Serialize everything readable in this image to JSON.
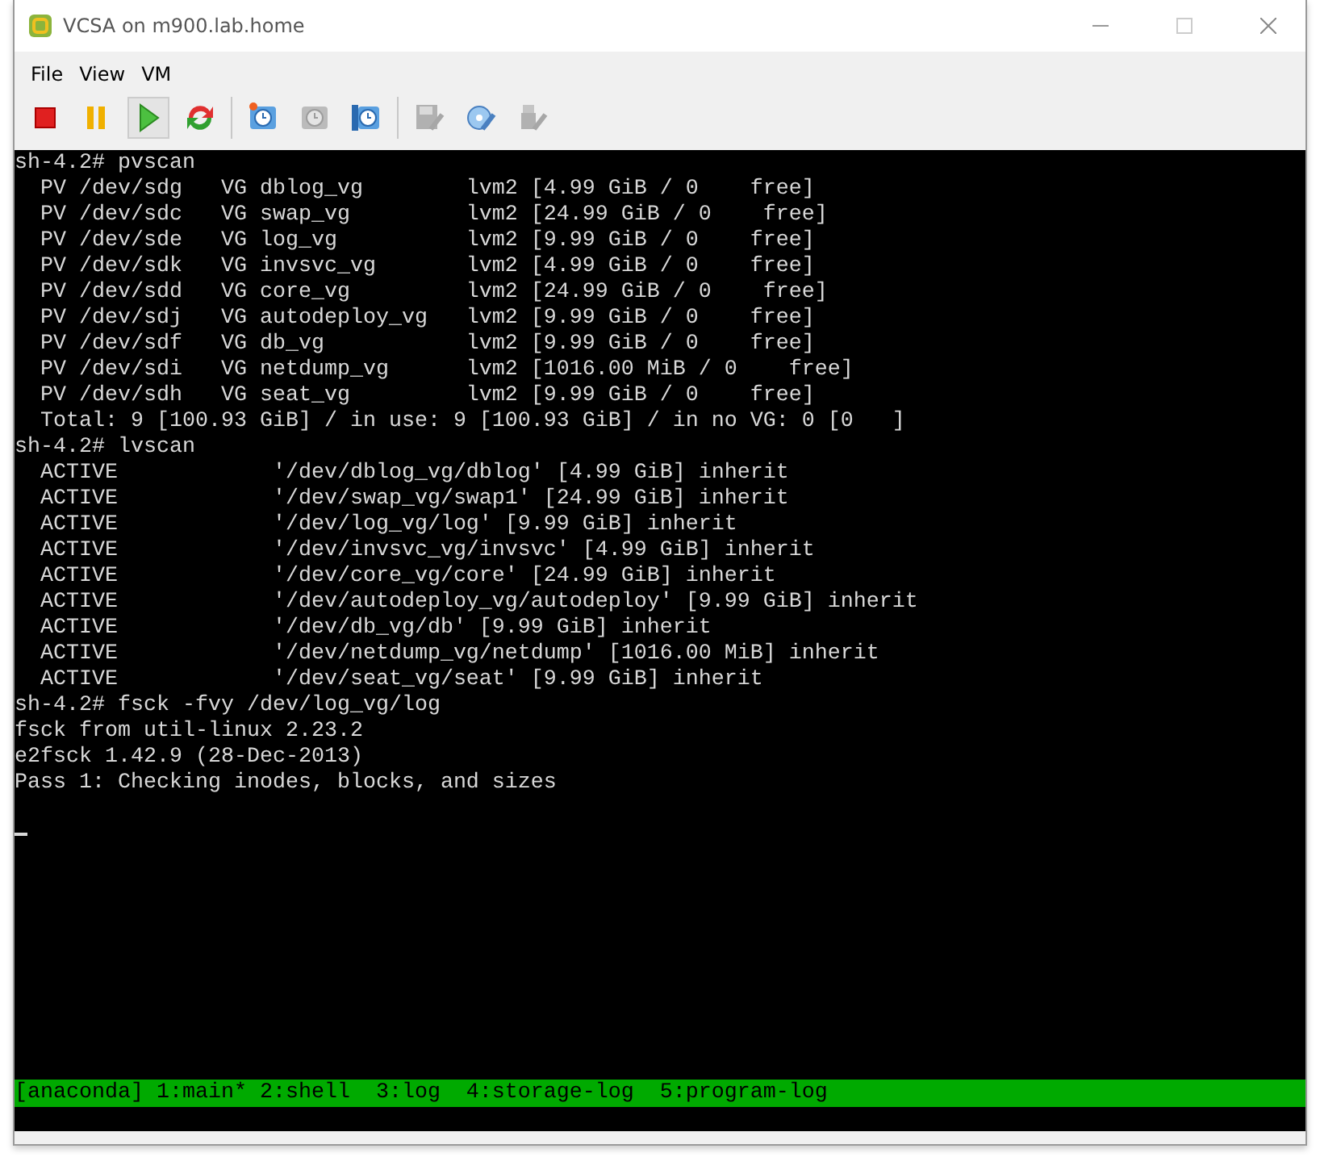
{
  "window": {
    "title": "VCSA on m900.lab.home"
  },
  "menu": [
    "File",
    "View",
    "VM"
  ],
  "toolbar": [
    {
      "kind": "stop",
      "disabled": false,
      "pressed": false
    },
    {
      "kind": "pause",
      "disabled": false,
      "pressed": false
    },
    {
      "kind": "play",
      "disabled": false,
      "pressed": true
    },
    {
      "kind": "reset",
      "disabled": false,
      "pressed": false
    },
    {
      "kind": "separator"
    },
    {
      "kind": "snapshot-take",
      "disabled": false,
      "pressed": false
    },
    {
      "kind": "snapshot-revert",
      "disabled": true,
      "pressed": false
    },
    {
      "kind": "snapshot-manage",
      "disabled": false,
      "pressed": false
    },
    {
      "kind": "separator"
    },
    {
      "kind": "floppy",
      "disabled": true,
      "pressed": false
    },
    {
      "kind": "cd",
      "disabled": false,
      "pressed": false
    },
    {
      "kind": "usb",
      "disabled": true,
      "pressed": false
    }
  ],
  "terminal": {
    "lines": [
      "sh-4.2# pvscan",
      "  PV /dev/sdg   VG dblog_vg        lvm2 [4.99 GiB / 0    free]",
      "  PV /dev/sdc   VG swap_vg         lvm2 [24.99 GiB / 0    free]",
      "  PV /dev/sde   VG log_vg          lvm2 [9.99 GiB / 0    free]",
      "  PV /dev/sdk   VG invsvc_vg       lvm2 [4.99 GiB / 0    free]",
      "  PV /dev/sdd   VG core_vg         lvm2 [24.99 GiB / 0    free]",
      "  PV /dev/sdj   VG autodeploy_vg   lvm2 [9.99 GiB / 0    free]",
      "  PV /dev/sdf   VG db_vg           lvm2 [9.99 GiB / 0    free]",
      "  PV /dev/sdi   VG netdump_vg      lvm2 [1016.00 MiB / 0    free]",
      "  PV /dev/sdh   VG seat_vg         lvm2 [9.99 GiB / 0    free]",
      "  Total: 9 [100.93 GiB] / in use: 9 [100.93 GiB] / in no VG: 0 [0   ]",
      "sh-4.2# lvscan",
      "  ACTIVE            '/dev/dblog_vg/dblog' [4.99 GiB] inherit",
      "  ACTIVE            '/dev/swap_vg/swap1' [24.99 GiB] inherit",
      "  ACTIVE            '/dev/log_vg/log' [9.99 GiB] inherit",
      "  ACTIVE            '/dev/invsvc_vg/invsvc' [4.99 GiB] inherit",
      "  ACTIVE            '/dev/core_vg/core' [24.99 GiB] inherit",
      "  ACTIVE            '/dev/autodeploy_vg/autodeploy' [9.99 GiB] inherit",
      "  ACTIVE            '/dev/db_vg/db' [9.99 GiB] inherit",
      "  ACTIVE            '/dev/netdump_vg/netdump' [1016.00 MiB] inherit",
      "  ACTIVE            '/dev/seat_vg/seat' [9.99 GiB] inherit",
      "sh-4.2# fsck -fvy /dev/log_vg/log",
      "fsck from util-linux 2.23.2",
      "e2fsck 1.42.9 (28-Dec-2013)",
      "Pass 1: Checking inodes, blocks, and sizes"
    ],
    "cursor": true,
    "status_bar": "[anaconda] 1:main* 2:shell  3:log  4:storage-log  5:program-log"
  }
}
